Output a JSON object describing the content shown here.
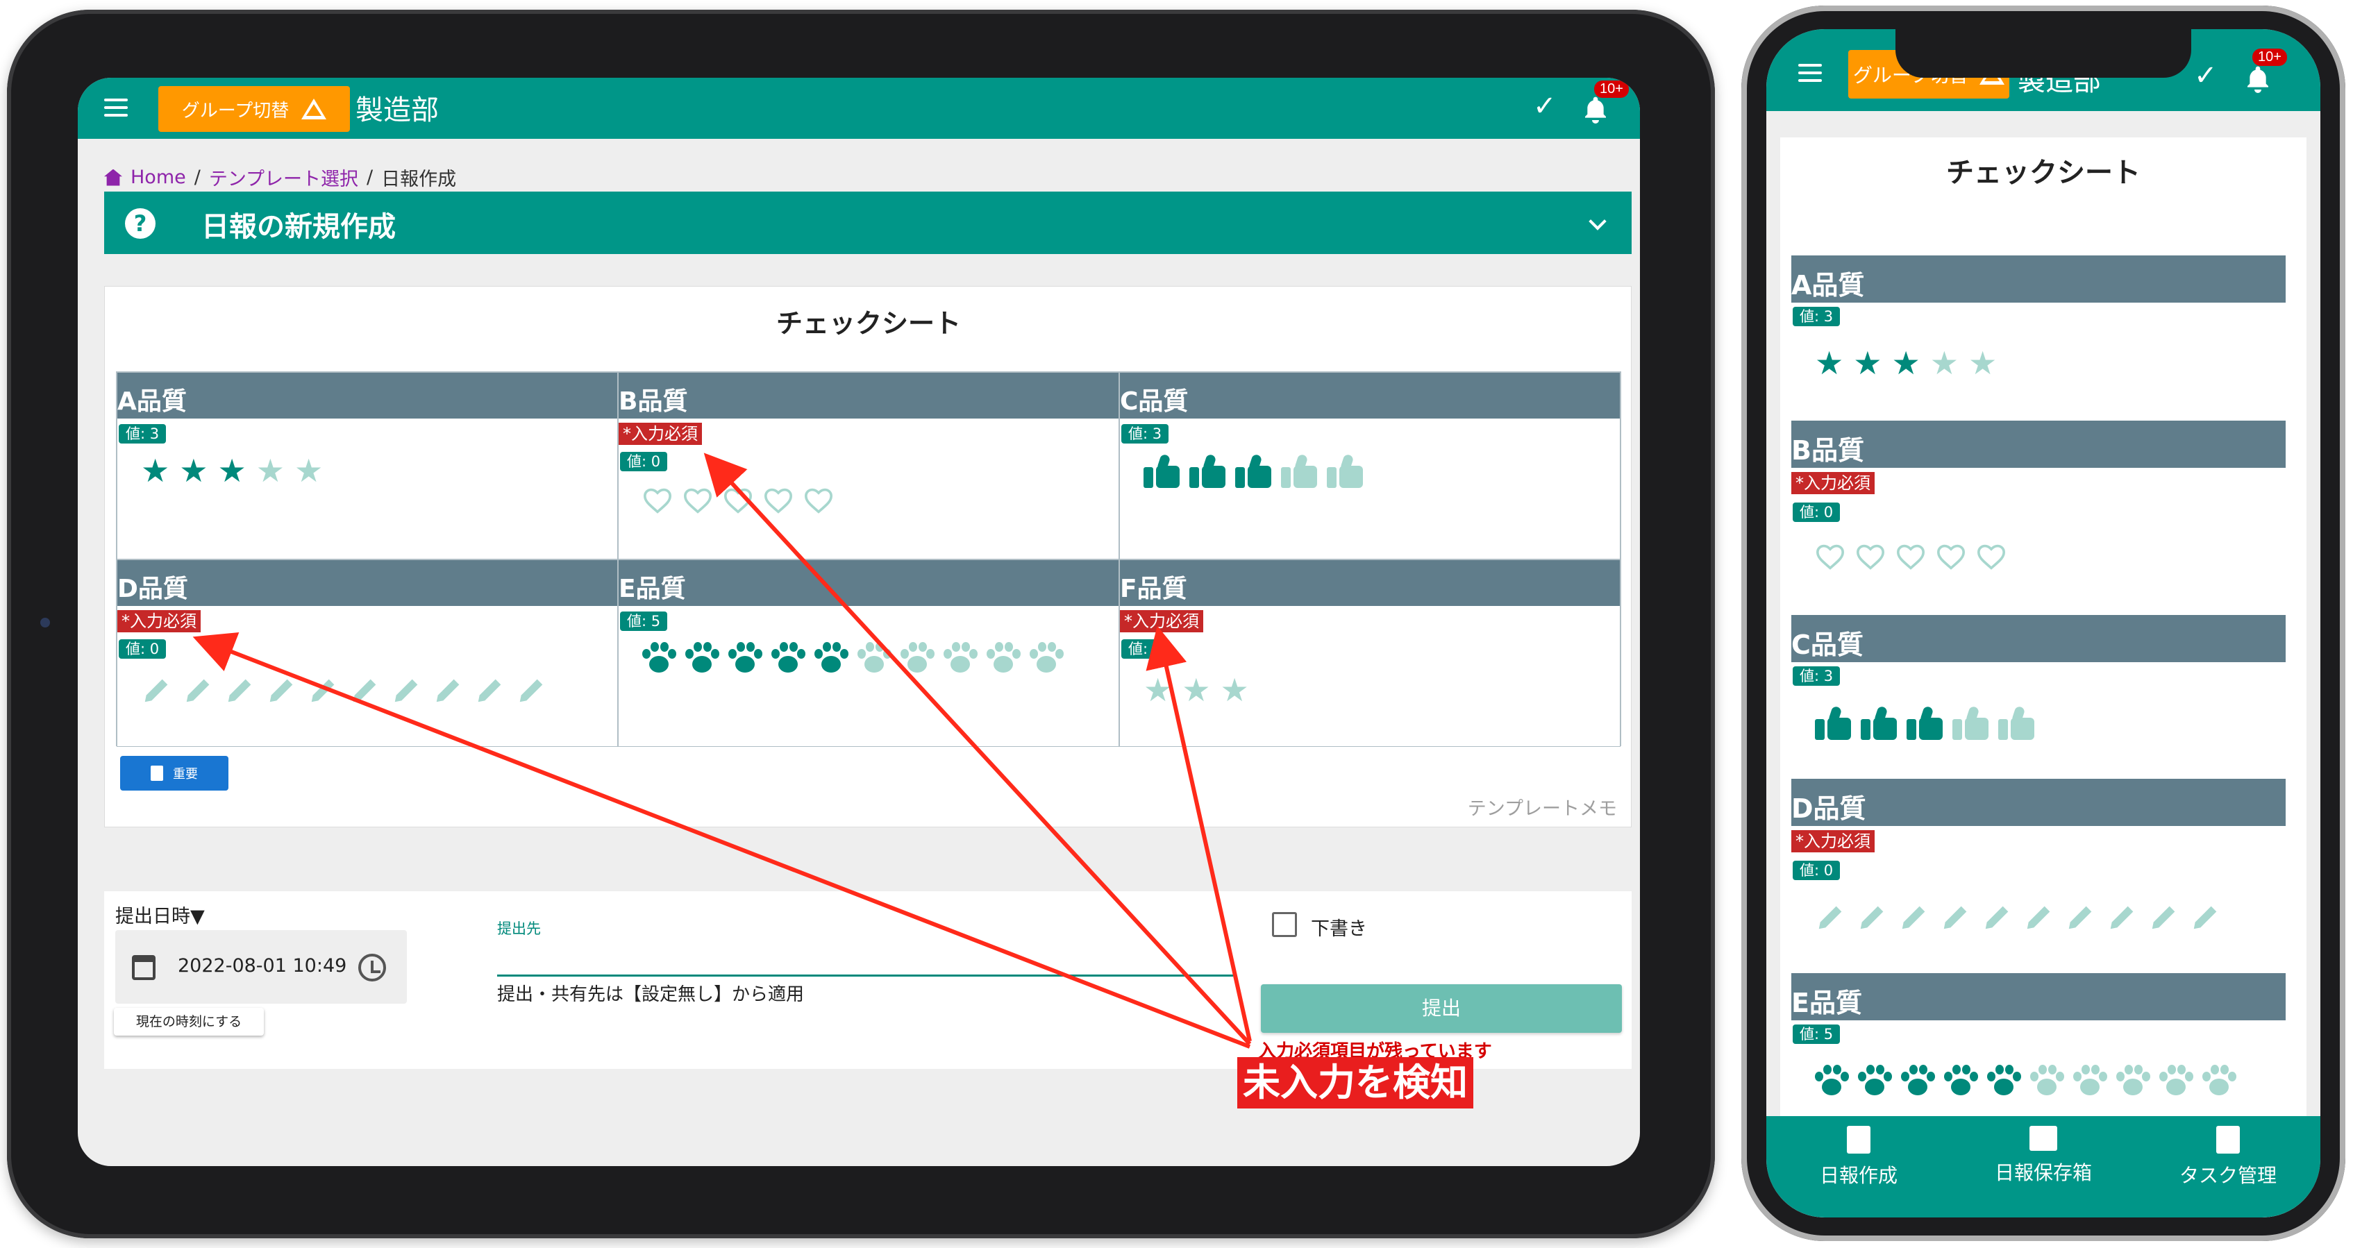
{
  "app": {
    "group_switch": "グループ切替",
    "dept": "製造部",
    "notif_badge": "10+"
  },
  "breadcrumb": {
    "home": "Home",
    "template": "テンプレート選択",
    "current": "日報作成",
    "sep": "/"
  },
  "page_title": "日報の新規作成",
  "sheet": {
    "title": "チェックシート",
    "required_label": "*入力必須",
    "items": [
      {
        "name": "A品質",
        "value_label": "値: 3",
        "icon": "star",
        "total": 5,
        "filled": 3,
        "required": false
      },
      {
        "name": "B品質",
        "value_label": "値: 0",
        "icon": "heart",
        "total": 5,
        "filled": 0,
        "required": true
      },
      {
        "name": "C品質",
        "value_label": "値: 3",
        "icon": "thumbs-up",
        "total": 5,
        "filled": 3,
        "required": false
      },
      {
        "name": "D品質",
        "value_label": "値: 0",
        "icon": "pencil",
        "total": 10,
        "filled": 0,
        "required": true
      },
      {
        "name": "E品質",
        "value_label": "値: 5",
        "icon": "paw",
        "total": 10,
        "filled": 5,
        "required": false
      },
      {
        "name": "F品質",
        "value_label": "値: 0",
        "icon": "star",
        "total": 3,
        "filled": 0,
        "required": true
      }
    ],
    "important_btn": "重要",
    "template_memo": "テンプレートメモ"
  },
  "form": {
    "date_label": "提出日時▼",
    "date_value": "2022-08-01 10:49",
    "now_btn": "現在の時刻にする",
    "submit_to_label": "提出先",
    "submit_to_note": "提出・共有先は【設定無し】から適用",
    "draft_label": "下書き",
    "submit_btn": "提出"
  },
  "annotation": {
    "warning": "入力必須項目が残っています",
    "callout": "未入力を検知"
  },
  "phone": {
    "group_switch": "グループ切替",
    "dept": "製造部",
    "notif_badge": "10+",
    "nav": [
      "日報作成",
      "日報保存箱",
      "タスク管理"
    ]
  },
  "colors": {
    "teal": "#009688",
    "orange": "#ff9800",
    "slate": "#607d8b",
    "required": "#c62828",
    "icon_on": "#00897b",
    "icon_off": "#a7d7ce"
  }
}
